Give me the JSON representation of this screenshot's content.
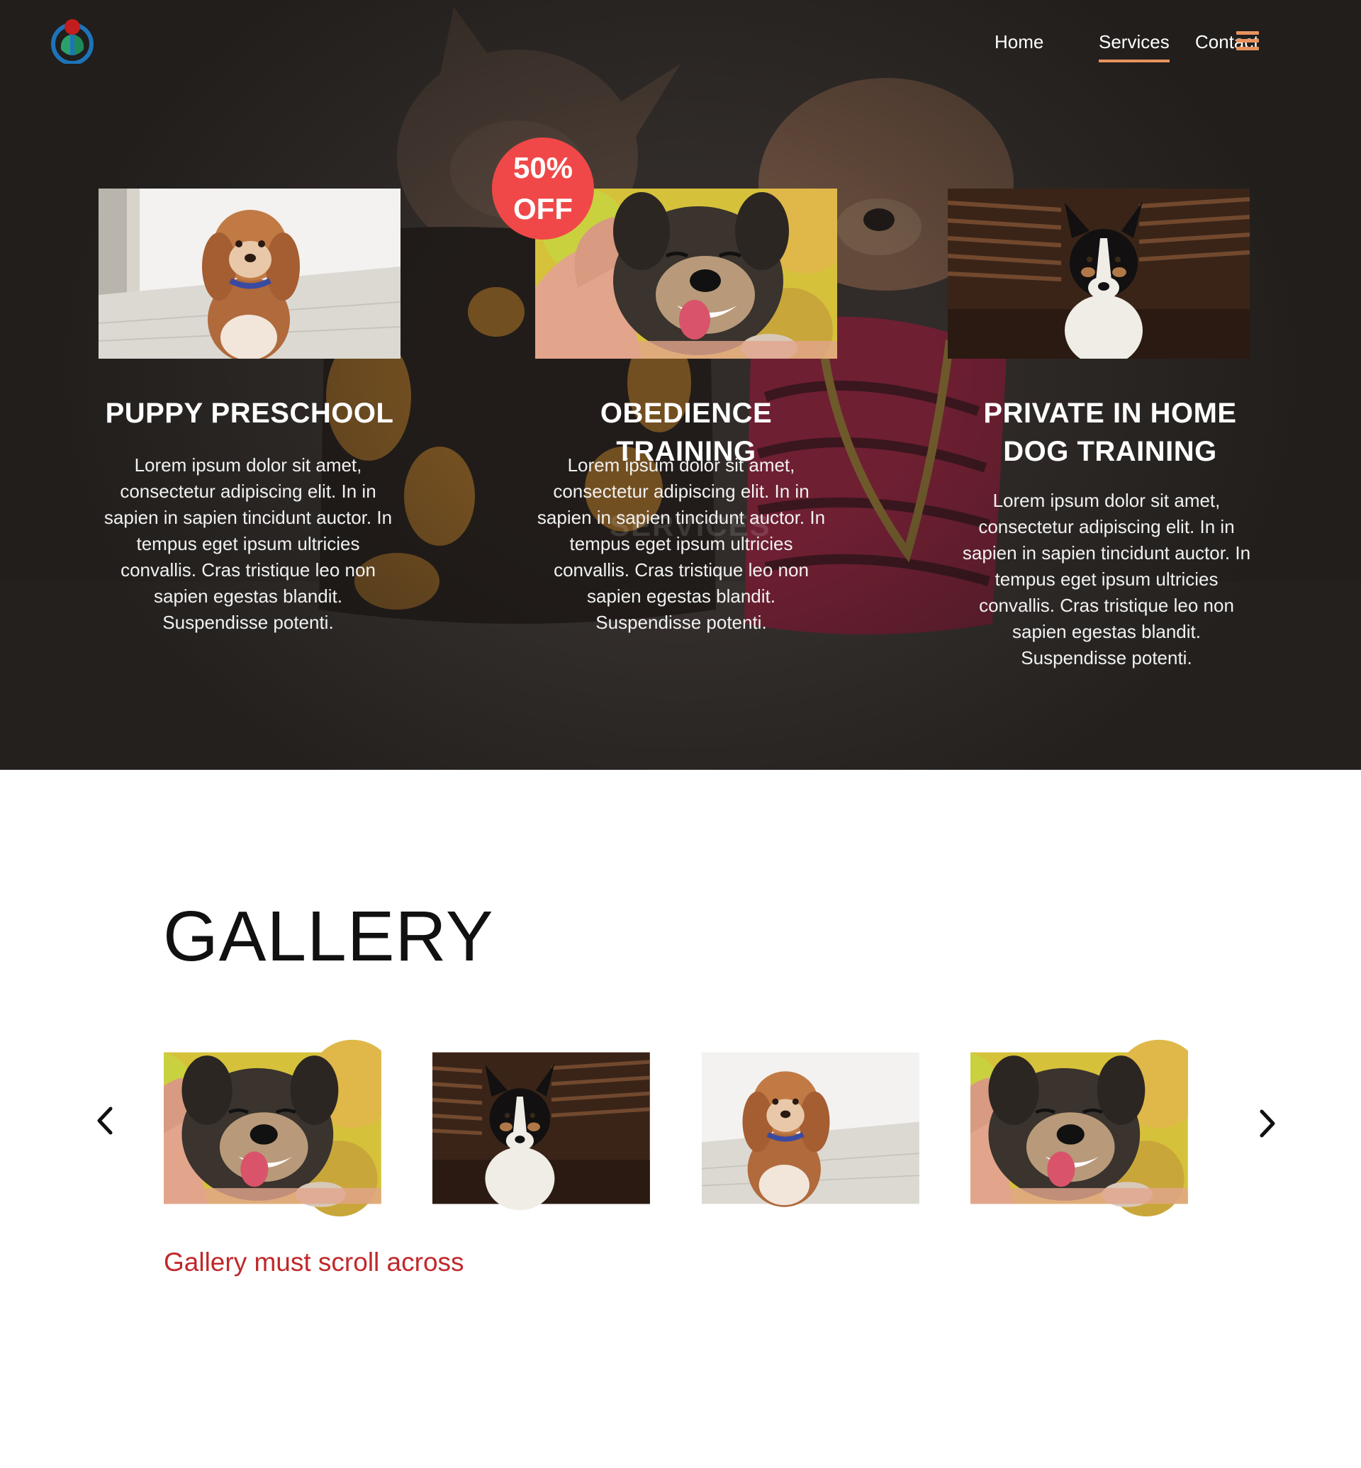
{
  "nav": {
    "logo_icon": "wikimedia-logo-icon",
    "links": [
      "Home",
      "Services",
      "Contact"
    ],
    "active": "Services",
    "menu_icon": "hamburger-menu-icon",
    "accent": "#e8935e"
  },
  "hero": {
    "watermark": "SERVICES",
    "badge": {
      "line1": "50%",
      "line2": "OFF",
      "color": "#f04848"
    },
    "services": [
      {
        "title": "PUPPY PRESCHOOL",
        "image": "dog-photo-fluffy-puppy",
        "text": "Lorem ipsum dolor sit amet, consectetur adipiscing elit. In in sapien in sapien tincidunt auctor. In tempus eget ipsum ultricies convallis. Cras tristique leo non sapien egestas blandit. Suspendisse potenti."
      },
      {
        "title": "OBEDIENCE TRAINING",
        "image": "dog-photo-happy-pet",
        "text": "Lorem ipsum dolor sit amet, consectetur adipiscing elit. In in sapien in sapien tincidunt auctor. In tempus eget ipsum ultricies convallis. Cras tristique leo non sapien egestas blandit. Suspendisse potenti."
      },
      {
        "title": "PRIVATE IN HOME DOG TRAINING",
        "image": "dog-photo-border-collie",
        "text": "Lorem ipsum dolor sit amet, consectetur adipiscing elit. In in sapien in sapien tincidunt auctor. In tempus eget ipsum ultricies convallis. Cras tristique leo non sapien egestas blandit. Suspendisse potenti."
      }
    ]
  },
  "gallery": {
    "title": "GALLERY",
    "prev_icon": "chevron-left-icon",
    "next_icon": "chevron-right-icon",
    "images": [
      "dog-photo-happy-pet",
      "dog-photo-border-collie",
      "dog-photo-fluffy-puppy",
      "dog-photo-happy-pet"
    ],
    "note": "Gallery must scroll across",
    "note_color": "#c0282a"
  }
}
